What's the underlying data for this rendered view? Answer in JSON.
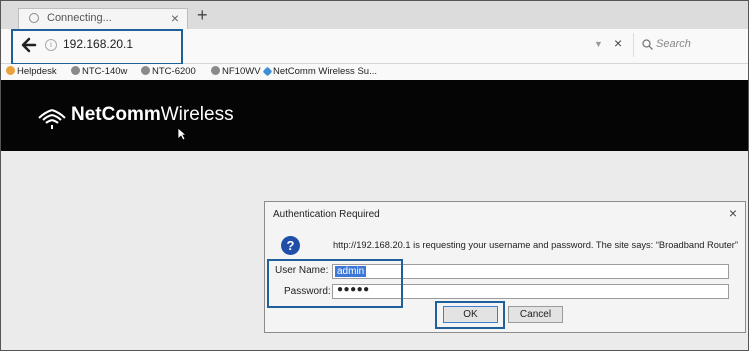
{
  "tab": {
    "title": "Connecting...",
    "close": "×",
    "new_tab": "+"
  },
  "navbar": {
    "url": "192.168.20.1",
    "info_glyph": "i",
    "dropdown_glyph": "▼",
    "stop_glyph": "×",
    "search_placeholder": "Search"
  },
  "bookmarks": [
    {
      "label": "Helpdesk",
      "color": "#e8a33a"
    },
    {
      "label": "NTC-140w",
      "color": "#8a8a8a"
    },
    {
      "label": "NTC-6200",
      "color": "#8a8a8a"
    },
    {
      "label": "NF10WV",
      "color": "#8a8a8a"
    },
    {
      "label": "NetComm Wireless Su...",
      "color": "#3d8fd6"
    }
  ],
  "page": {
    "brand_bold": "NetComm",
    "brand_regular": "Wireless"
  },
  "dialog": {
    "title": "Authentication Required",
    "close": "×",
    "icon_glyph": "?",
    "message": "http://192.168.20.1 is requesting your username and password. The site says: “Broadband Router”",
    "username_label": "User Name:",
    "username_value": "admin",
    "password_label": "Password:",
    "password_value": "●●●●●",
    "ok_label": "OK",
    "cancel_label": "Cancel"
  },
  "colors": {
    "highlight": "#1f5f9a",
    "selection": "#3d78d8",
    "hero_bg": "#050505"
  }
}
